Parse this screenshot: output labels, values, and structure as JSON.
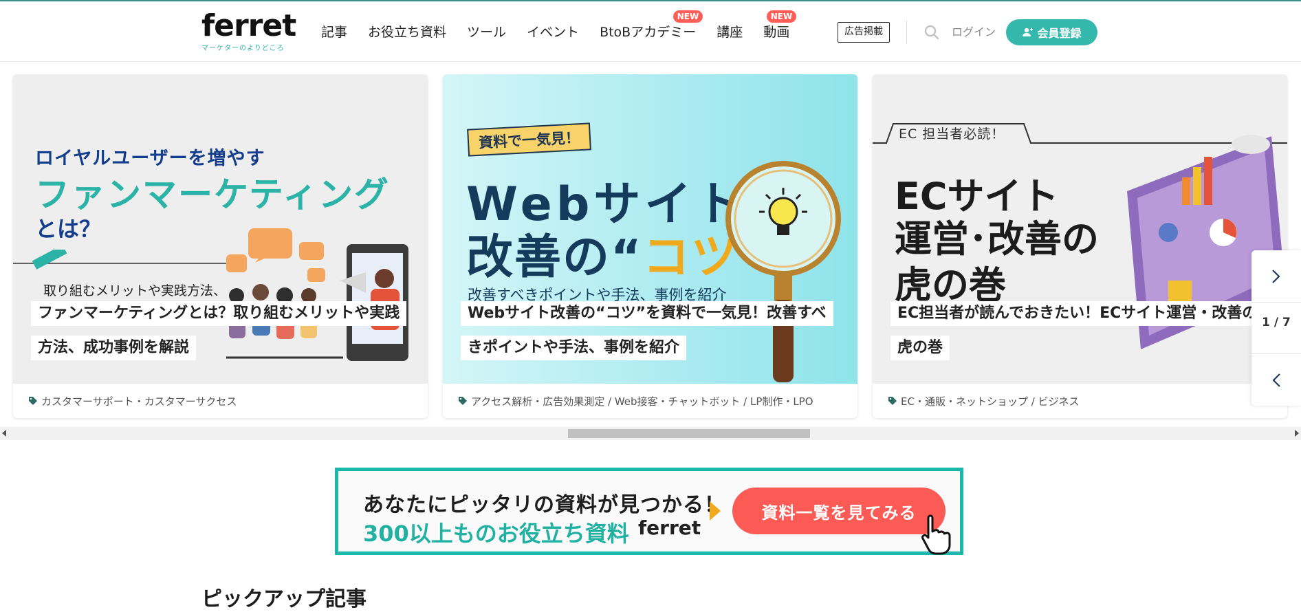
{
  "header": {
    "logo": {
      "word": "ferret",
      "tagline": "マーケターのよりどころ"
    },
    "nav": [
      {
        "label": "記事",
        "badge": ""
      },
      {
        "label": "お役立ち資料",
        "badge": ""
      },
      {
        "label": "ツール",
        "badge": ""
      },
      {
        "label": "イベント",
        "badge": ""
      },
      {
        "label": "BtoBアカデミー",
        "badge": "NEW"
      },
      {
        "label": "講座",
        "badge": ""
      },
      {
        "label": "動画",
        "badge": "NEW"
      }
    ],
    "ad_label": "広告掲載",
    "login_label": "ログイン",
    "register_label": "会員登録",
    "colors": {
      "accent": "#34b8ad",
      "badge": "#ff5e57"
    }
  },
  "carousel": {
    "counter": "1 / 7",
    "cards": [
      {
        "image_text": {
          "line1": "ロイヤルユーザーを増やす",
          "line2": "ファンマーケティング",
          "line3": "とは？",
          "sub": "取り組むメリットや実践方法、"
        },
        "caption_lines": [
          "ファンマーケティングとは？取り組むメリットや実践",
          "方法、成功事例を解説"
        ],
        "tag": "カスタマーサポート・カスタマーサクセス"
      },
      {
        "image_text": {
          "pill": "資料で一気見！",
          "line1": "Webサイト",
          "line2_a": "改善の“",
          "line2_b": "コツ",
          "line2_c": "”",
          "sub": "改善すべきポイントや手法、事例を紹介"
        },
        "caption_lines": [
          "Webサイト改善の“コツ”を資料で一気見！改善すべ",
          "きポイントや手法、事例を紹介"
        ],
        "tag": "アクセス解析・広告効果測定 / Web接客・チャットボット / LP制作・LPO"
      },
      {
        "image_text": {
          "tab": "EC 担当者必読！",
          "line1": "ECサイト",
          "line2": "運営･改善の",
          "line3": "虎の巻"
        },
        "caption_lines": [
          "EC担当者が読んでおきたい！ECサイト運営・改善の",
          "虎の巻"
        ],
        "tag": "EC・通販・ネットショップ / ビジネス"
      }
    ]
  },
  "banner": {
    "line1": "あなたにピッタリの資料が見つかる！",
    "line2": "300以上ものお役立ち資料",
    "logo": "ferret",
    "cta": "資料一覧を見てみる"
  },
  "section": {
    "title": "ピックアップ記事"
  }
}
